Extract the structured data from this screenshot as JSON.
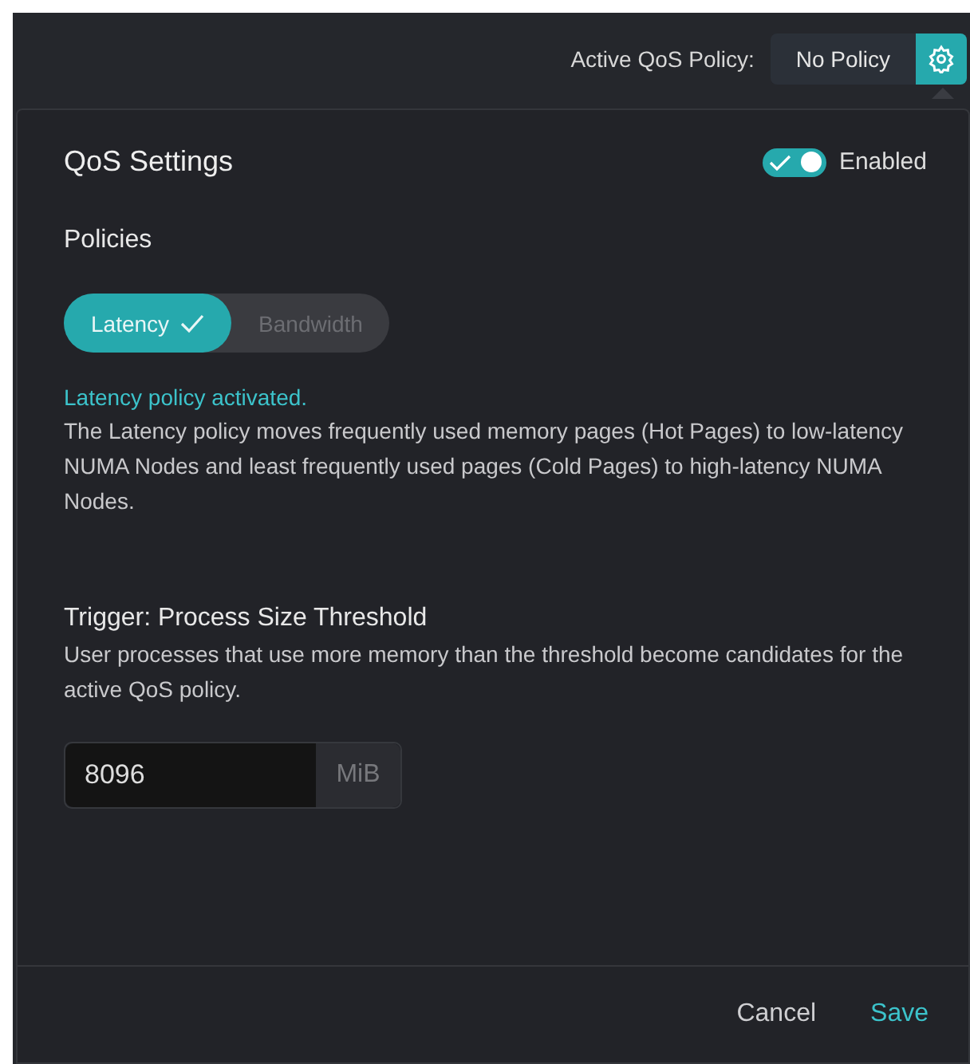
{
  "header": {
    "label": "Active QoS Policy:",
    "policy": "No Policy"
  },
  "panel": {
    "title": "QoS Settings",
    "toggle": {
      "label": "Enabled",
      "on": true
    },
    "policies_heading": "Policies",
    "policies": [
      {
        "label": "Latency",
        "selected": true
      },
      {
        "label": "Bandwidth",
        "selected": false
      }
    ],
    "status": "Latency policy activated.",
    "description": "The Latency policy moves frequently used memory pages (Hot Pages) to low-latency NUMA Nodes and least frequently used pages (Cold Pages) to high-latency NUMA Nodes.",
    "trigger": {
      "heading": "Trigger: Process Size Threshold",
      "description": "User processes that use more memory than the threshold become candidates for the active QoS policy.",
      "value": "8096",
      "unit": "MiB"
    },
    "buttons": {
      "cancel": "Cancel",
      "save": "Save"
    }
  }
}
